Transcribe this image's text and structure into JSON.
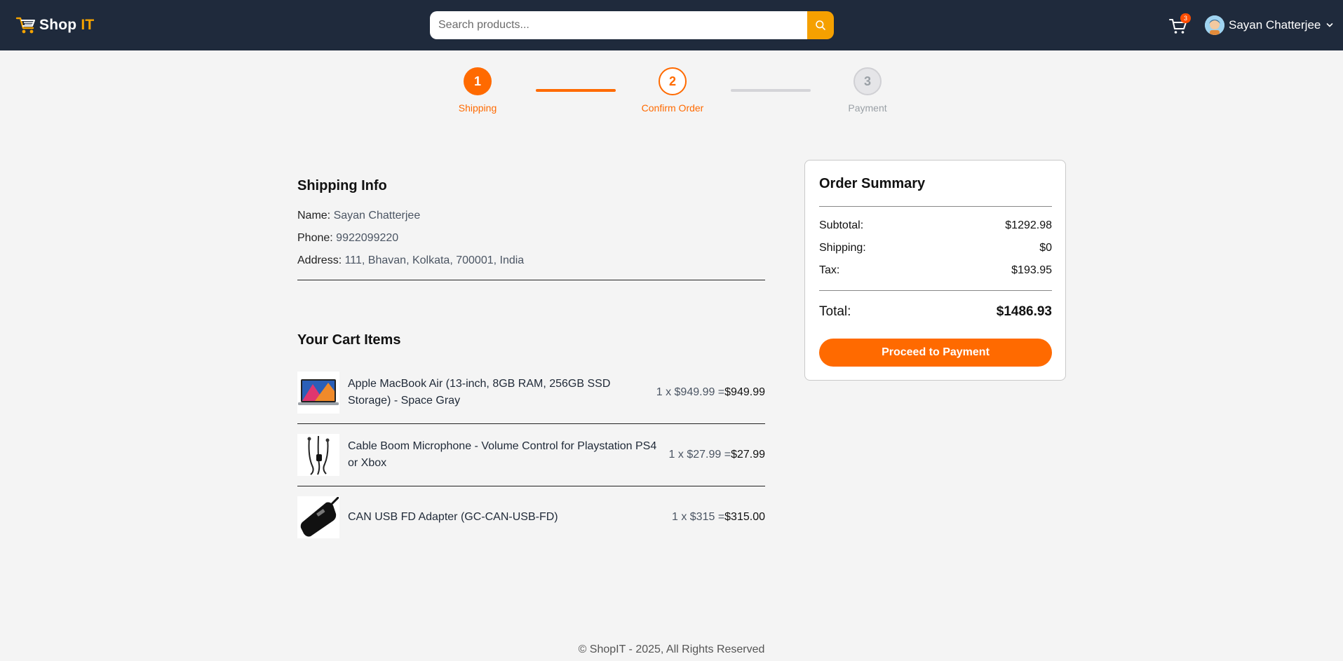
{
  "header": {
    "logo_main": "Shop",
    "logo_accent": "IT",
    "search_placeholder": "Search products...",
    "cart_count": "3",
    "user_name": "Sayan Chatterjee"
  },
  "steps": [
    {
      "number": "1",
      "label": "Shipping"
    },
    {
      "number": "2",
      "label": "Confirm Order"
    },
    {
      "number": "3",
      "label": "Payment"
    }
  ],
  "shipping": {
    "title": "Shipping Info",
    "name_key": "Name:",
    "name_val": "Sayan Chatterjee",
    "phone_key": "Phone:",
    "phone_val": "9922099220",
    "address_key": "Address:",
    "address_val": "111, Bhavan, Kolkata, 700001, India"
  },
  "cart": {
    "title": "Your Cart Items",
    "items": [
      {
        "name": "Apple MacBook Air (13-inch, 8GB RAM, 256GB SSD Storage) - Space Gray",
        "qty_price": "1 x $949.99 =",
        "total": "$949.99"
      },
      {
        "name": "Cable Boom Microphone - Volume Control for Playstation PS4 or Xbox",
        "qty_price": "1 x $27.99 =",
        "total": "$27.99"
      },
      {
        "name": "CAN USB FD Adapter (GC-CAN-USB-FD)",
        "qty_price": "1 x $315 =",
        "total": "$315.00"
      }
    ]
  },
  "summary": {
    "title": "Order Summary",
    "subtotal_label": "Subtotal:",
    "subtotal": "$1292.98",
    "shipping_label": "Shipping:",
    "shipping": "$0",
    "tax_label": "Tax:",
    "tax": "$193.95",
    "total_label": "Total:",
    "total": "$1486.93",
    "button": "Proceed to Payment"
  },
  "footer": "© ShopIT - 2025, All Rights Reserved",
  "colors": {
    "navbar": "#1f2a3c",
    "accent": "#ff6a00",
    "search_button": "#f5a000"
  }
}
